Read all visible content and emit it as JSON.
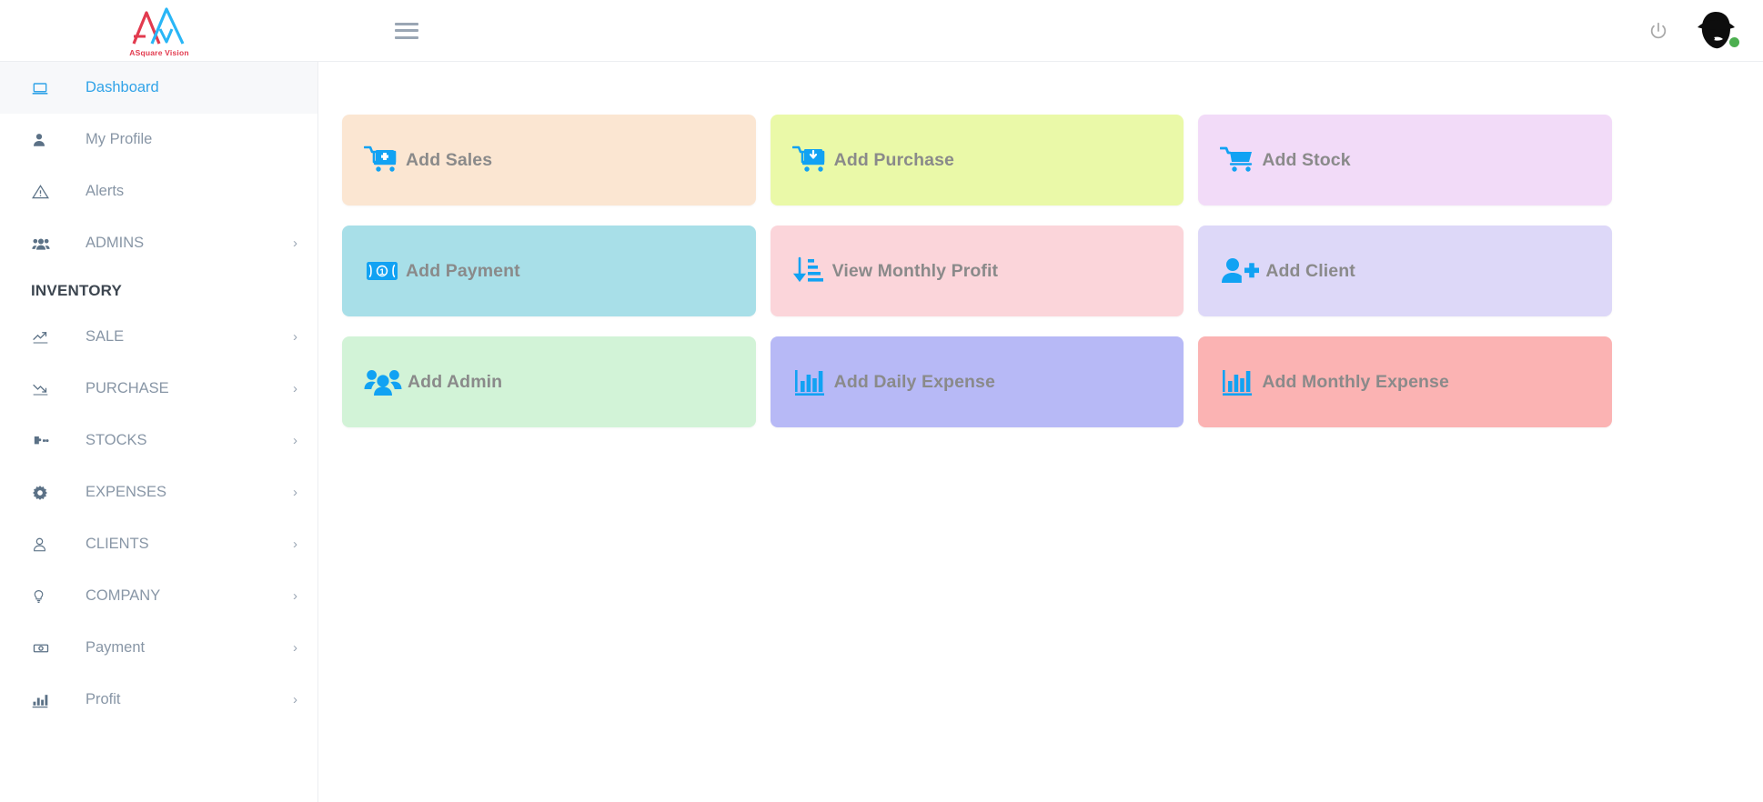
{
  "brand": {
    "name": "ASquare Vision",
    "logo_red": "#e23a4e",
    "logo_blue": "#29b6f6"
  },
  "topbar": {
    "menu_toggle_label": "menu-toggle",
    "power_label": "Logout",
    "avatar_label": "User avatar",
    "status_color": "#4caf50"
  },
  "sidebar": {
    "section_heading": "INVENTORY",
    "items": [
      {
        "label": "Dashboard",
        "icon": "laptop-icon",
        "active": true,
        "caret": false
      },
      {
        "label": "My Profile",
        "icon": "user-icon",
        "active": false,
        "caret": false
      },
      {
        "label": "Alerts",
        "icon": "warning-triangle-icon",
        "active": false,
        "caret": false
      },
      {
        "label": "ADMINS",
        "icon": "users-group-icon",
        "active": false,
        "caret": true
      }
    ],
    "inventory_items": [
      {
        "label": "SALE",
        "icon": "trend-up-icon",
        "caret": true
      },
      {
        "label": "PURCHASE",
        "icon": "trend-down-icon",
        "caret": true
      },
      {
        "label": "STOCKS",
        "icon": "puzzle-icon",
        "caret": true
      },
      {
        "label": "EXPENSES",
        "icon": "gear-icon",
        "caret": true
      },
      {
        "label": "CLIENTS",
        "icon": "person-outline-icon",
        "caret": true
      },
      {
        "label": "COMPANY",
        "icon": "lightbulb-icon",
        "caret": true
      },
      {
        "label": "Payment",
        "icon": "banknote-icon",
        "caret": true
      },
      {
        "label": "Profit",
        "icon": "bar-chart-icon",
        "caret": true
      }
    ],
    "caret_glyph": "›"
  },
  "main": {
    "cards": [
      {
        "label": "Add Sales",
        "icon": "cart-plus-icon",
        "bg": "#fbe6d2"
      },
      {
        "label": "Add Purchase",
        "icon": "cart-download-icon",
        "bg": "#eaf9a8"
      },
      {
        "label": "Add Stock",
        "icon": "cart-icon",
        "bg": "#f2dbf8"
      },
      {
        "label": "Add Payment",
        "icon": "banknote-icon",
        "bg": "#a8dfe8"
      },
      {
        "label": "View Monthly Profit",
        "icon": "sort-descending-icon",
        "bg": "#fbd5da"
      },
      {
        "label": "Add Client",
        "icon": "user-plus-icon",
        "bg": "#ddd8f8"
      },
      {
        "label": "Add Admin",
        "icon": "users-group-icon",
        "bg": "#d2f3d7"
      },
      {
        "label": "Add Daily Expense",
        "icon": "bar-chart-icon",
        "bg": "#b7b9f6"
      },
      {
        "label": "Add Monthly Expense",
        "icon": "bar-chart-icon",
        "bg": "#fbb3b3"
      }
    ],
    "icon_color": "#11a2f3"
  }
}
